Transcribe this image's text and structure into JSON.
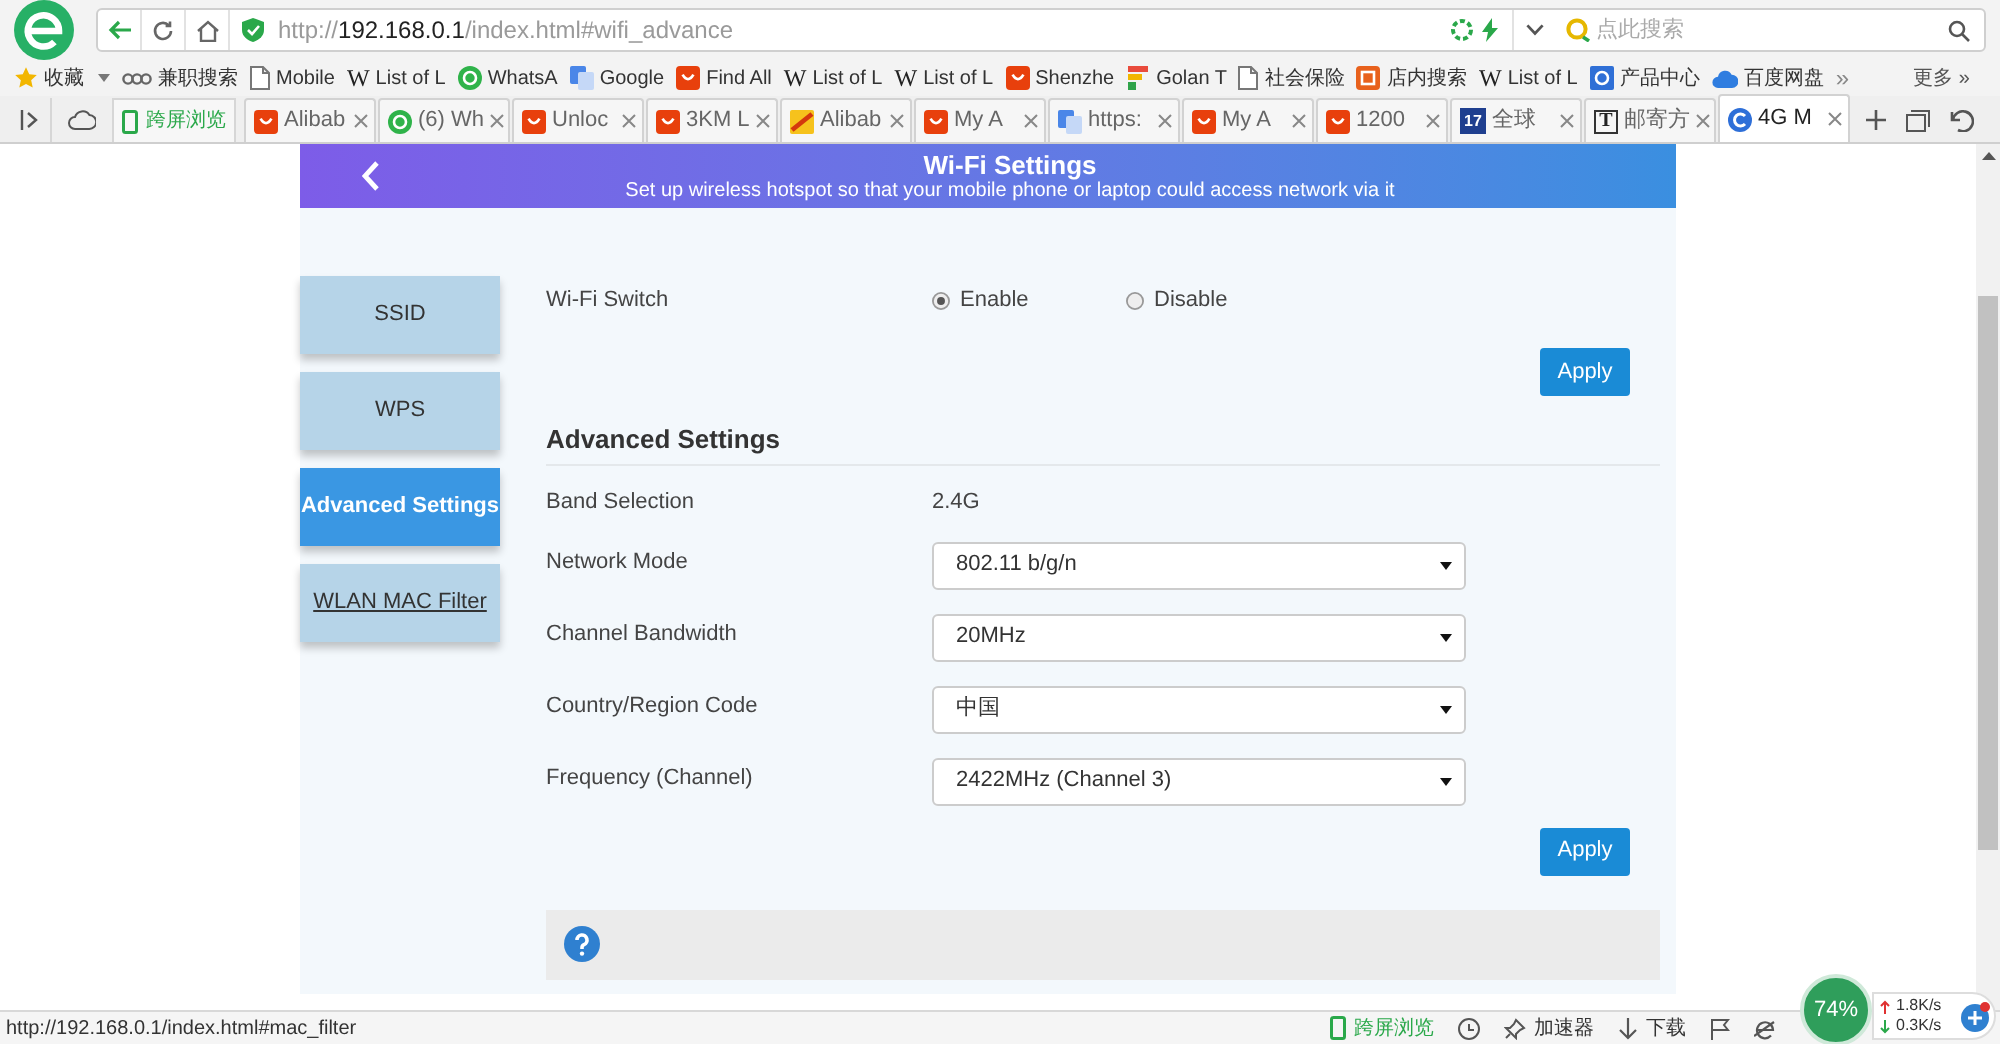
{
  "toolbar": {
    "url_parts": [
      "http://",
      "192.168.0.1",
      "/index.html#wifi_advance"
    ],
    "search_placeholder": "点此搜索"
  },
  "bookmarks": {
    "items": [
      {
        "kind": "star",
        "label": "收藏"
      },
      {
        "kind": "dots",
        "label": "兼职搜索"
      },
      {
        "kind": "page",
        "label": "Mobile"
      },
      {
        "kind": "letter",
        "glyph": "W",
        "label": "List of L"
      },
      {
        "kind": "chat",
        "label": "WhatsA"
      },
      {
        "kind": "translate",
        "label": "Google"
      },
      {
        "kind": "smile",
        "label": "Find All"
      },
      {
        "kind": "letter",
        "glyph": "W",
        "label": "List of L"
      },
      {
        "kind": "letter",
        "glyph": "W",
        "label": "List of L"
      },
      {
        "kind": "smile",
        "label": "Shenzhe"
      },
      {
        "kind": "stripes",
        "label": "Golan T"
      },
      {
        "kind": "page",
        "label": "社会保险"
      },
      {
        "kind": "tag",
        "label": "店内搜索"
      },
      {
        "kind": "letter",
        "glyph": "W",
        "label": "List of L"
      },
      {
        "kind": "bubble",
        "label": "产品中心"
      },
      {
        "kind": "cloud",
        "label": "百度网盘"
      }
    ],
    "overflow": "»",
    "more": "更多 »"
  },
  "tab_strip": {
    "cross_screen": "跨屏浏览",
    "tabs": [
      {
        "kind": "smile",
        "label": "Alibab",
        "selected": false
      },
      {
        "kind": "chat",
        "label": "(6) Wh",
        "selected": false
      },
      {
        "kind": "smile",
        "label": "Unloc",
        "selected": false
      },
      {
        "kind": "smile",
        "label": "3KM L",
        "selected": false
      },
      {
        "kind": "flag",
        "label": "Alibab",
        "selected": false
      },
      {
        "kind": "smile",
        "label": "My A",
        "selected": false
      },
      {
        "kind": "translate",
        "label": "https:",
        "selected": false
      },
      {
        "kind": "smile",
        "label": "My A",
        "selected": false
      },
      {
        "kind": "smile",
        "label": "1200",
        "selected": false
      },
      {
        "kind": "tile",
        "glyph": "17",
        "label": "全球",
        "selected": false
      },
      {
        "kind": "boxed",
        "glyph": "T",
        "label": "邮寄方",
        "selected": false
      },
      {
        "kind": "swirl",
        "label": "4G M",
        "selected": true
      }
    ]
  },
  "page": {
    "banner": {
      "title": "Wi-Fi Settings",
      "subtitle": "Set up wireless hotspot so that your mobile phone or laptop could access network via it"
    },
    "sidebar": [
      {
        "label": "SSID",
        "selected": false,
        "hovered": false
      },
      {
        "label": "WPS",
        "selected": false,
        "hovered": false
      },
      {
        "label": "Advanced Settings",
        "selected": true,
        "hovered": false
      },
      {
        "label": "WLAN MAC Filter",
        "selected": false,
        "hovered": true
      }
    ],
    "wifi_switch": {
      "label": "Wi-Fi Switch",
      "options": [
        {
          "label": "Enable",
          "selected": true
        },
        {
          "label": "Disable",
          "selected": false
        }
      ],
      "apply": "Apply"
    },
    "advanced": {
      "heading": "Advanced Settings",
      "rows": [
        {
          "kind": "text",
          "label": "Band Selection",
          "value": "2.4G"
        },
        {
          "kind": "select",
          "label": "Network Mode",
          "value": "802.11 b/g/n"
        },
        {
          "kind": "select",
          "label": "Channel Bandwidth",
          "value": "20MHz"
        },
        {
          "kind": "select",
          "label": "Country/Region Code",
          "value": "中国"
        },
        {
          "kind": "select",
          "label": "Frequency (Channel)",
          "value": "2422MHz (Channel 3)"
        }
      ],
      "apply": "Apply"
    }
  },
  "status_bar": {
    "url": "http://192.168.0.1/index.html#mac_filter",
    "items": [
      {
        "kind": "phone",
        "label": "跨屏浏览"
      },
      {
        "kind": "pin",
        "label": "加速器"
      },
      {
        "kind": "download",
        "label": "下载"
      }
    ],
    "memory": "74%",
    "upload": "1.8K/s",
    "download": "0.3K/s"
  }
}
